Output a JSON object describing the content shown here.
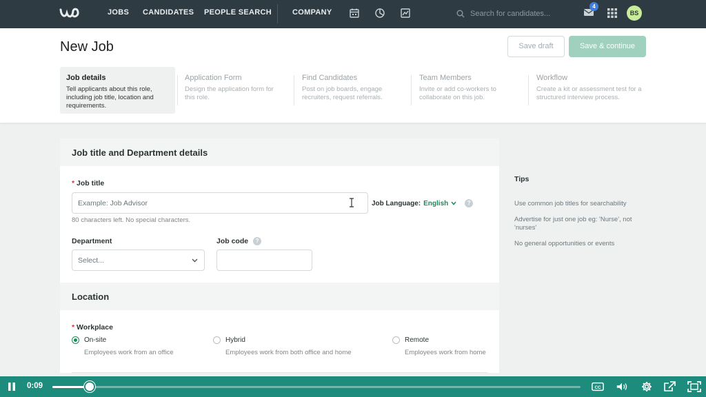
{
  "nav": {
    "items": [
      "JOBS",
      "CANDIDATES",
      "PEOPLE SEARCH",
      "COMPANY"
    ],
    "search_placeholder": "Search for candidates...",
    "mail_count": "4",
    "avatar_initials": "BS"
  },
  "page": {
    "title": "New Job",
    "save_draft": "Save draft",
    "save_continue": "Save & continue"
  },
  "steps": [
    {
      "title": "Job details",
      "desc": "Tell applicants about this role, including job title, location and requirements."
    },
    {
      "title": "Application Form",
      "desc": "Design the application form for this role."
    },
    {
      "title": "Find Candidates",
      "desc": "Post on job boards, engage recruiters, request referrals."
    },
    {
      "title": "Team Members",
      "desc": "Invite or add co-workers to collaborate on this job."
    },
    {
      "title": "Workflow",
      "desc": "Create a kit or assessment test for a structured interview process."
    }
  ],
  "form": {
    "section_title": "Job title and Department details",
    "required_mark": "*",
    "job_title_label": "Job title",
    "job_title_placeholder": "Example: Job Advisor",
    "job_title_hint": "80 characters left. No special characters.",
    "language_label": "Job Language:",
    "language_value": "English",
    "department_label": "Department",
    "department_placeholder": "Select...",
    "job_code_label": "Job code",
    "help": "?"
  },
  "location": {
    "section_title": "Location",
    "workplace_label": "Workplace",
    "options": [
      {
        "label": "On-site",
        "desc": "Employees work from an office",
        "selected": true
      },
      {
        "label": "Hybrid",
        "desc": "Employees work from both office and home",
        "selected": false
      },
      {
        "label": "Remote",
        "desc": "Employees work from home",
        "selected": false
      }
    ]
  },
  "tips": {
    "title": "Tips",
    "items": [
      "Use common job titles for searchability",
      "Advertise for just one job eg: 'Nurse', not 'nurses'",
      "No general opportunities or events"
    ]
  },
  "video": {
    "time": "0:09",
    "progress": 0.07
  },
  "colors": {
    "nav_bg": "#2f3b42",
    "accent_green": "#1a8a5a",
    "continue_btn": "#9fd1be",
    "video_bar": "#1e8c7c"
  }
}
